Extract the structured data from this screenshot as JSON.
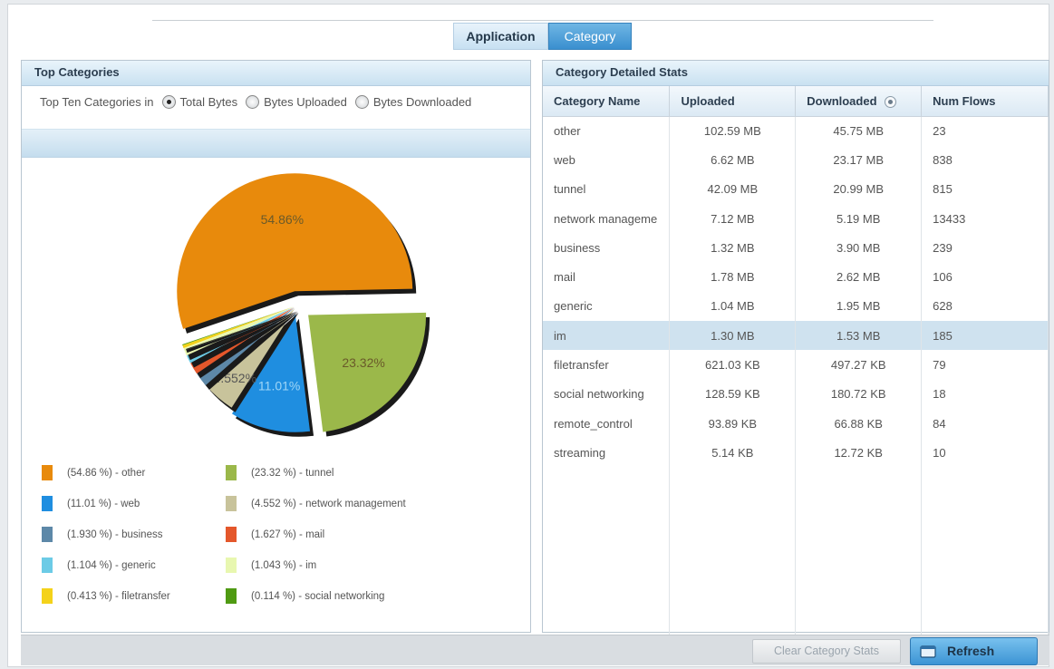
{
  "tabs": [
    {
      "label": "Application"
    },
    {
      "label": "Category"
    }
  ],
  "left_panel": {
    "title": "Top Categories",
    "radio_prefix": "Top Ten Categories in",
    "radios": [
      {
        "label": "Total Bytes",
        "checked": true
      },
      {
        "label": "Bytes Uploaded",
        "checked": false
      },
      {
        "label": "Bytes Downloaded",
        "checked": false
      }
    ]
  },
  "chart_data": {
    "type": "pie",
    "labels_on_chart": [
      "54.86%",
      "23.32%",
      "11.01%",
      "4.552%"
    ],
    "slices": [
      {
        "name": "other",
        "percent": 54.86,
        "color": "#e88a0c"
      },
      {
        "name": "tunnel",
        "percent": 23.32,
        "color": "#9bb84a"
      },
      {
        "name": "web",
        "percent": 11.01,
        "color": "#1f8ee0"
      },
      {
        "name": "network management",
        "percent": 4.552,
        "color": "#c8c39b"
      },
      {
        "name": "business",
        "percent": 1.93,
        "color": "#5d88a8"
      },
      {
        "name": "mail",
        "percent": 1.627,
        "color": "#e4572b"
      },
      {
        "name": "generic",
        "percent": 1.104,
        "color": "#6ccbe6"
      },
      {
        "name": "im",
        "percent": 1.043,
        "color": "#e8f7b0"
      },
      {
        "name": "filetransfer",
        "percent": 0.413,
        "color": "#f4d21a"
      },
      {
        "name": "social networking",
        "percent": 0.114,
        "color": "#4f9a12"
      }
    ]
  },
  "legend": [
    {
      "text": "(54.86 %) - other",
      "color": "#e88a0c"
    },
    {
      "text": "(23.32 %) - tunnel",
      "color": "#9bb84a"
    },
    {
      "text": "(11.01 %) - web",
      "color": "#1f8ee0"
    },
    {
      "text": "(4.552 %) - network management",
      "color": "#c8c39b"
    },
    {
      "text": "(1.930 %) - business",
      "color": "#5d88a8"
    },
    {
      "text": "(1.627 %) - mail",
      "color": "#e4572b"
    },
    {
      "text": "(1.104 %) - generic",
      "color": "#6ccbe6"
    },
    {
      "text": "(1.043 %) - im",
      "color": "#e8f7b0"
    },
    {
      "text": "(0.413 %) - filetransfer",
      "color": "#f4d21a"
    },
    {
      "text": "(0.114 %) - social networking",
      "color": "#4f9a12"
    }
  ],
  "right_panel": {
    "title": "Category Detailed Stats",
    "columns": [
      "Category Name",
      "Uploaded",
      "Downloaded",
      "Num Flows"
    ],
    "rows": [
      [
        "other",
        "102.59 MB",
        "45.75 MB",
        "23"
      ],
      [
        "web",
        "6.62 MB",
        "23.17 MB",
        "838"
      ],
      [
        "tunnel",
        "42.09 MB",
        "20.99 MB",
        "815"
      ],
      [
        "network manageme",
        "7.12 MB",
        "5.19 MB",
        "13433"
      ],
      [
        "business",
        "1.32 MB",
        "3.90 MB",
        "239"
      ],
      [
        "mail",
        "1.78 MB",
        "2.62 MB",
        "106"
      ],
      [
        "generic",
        "1.04 MB",
        "1.95 MB",
        "628"
      ],
      [
        "im",
        "1.30 MB",
        "1.53 MB",
        "185"
      ],
      [
        "filetransfer",
        "621.03 KB",
        "497.27 KB",
        "79"
      ],
      [
        "social networking",
        "128.59 KB",
        "180.72 KB",
        "18"
      ],
      [
        "remote_control",
        "93.89 KB",
        "66.88 KB",
        "84"
      ],
      [
        "streaming",
        "5.14 KB",
        "12.72 KB",
        "10"
      ]
    ],
    "selected_row": 7,
    "empty_rows": 6
  },
  "footer": {
    "clear_label": "Clear Category Stats",
    "refresh_label": "Refresh"
  }
}
